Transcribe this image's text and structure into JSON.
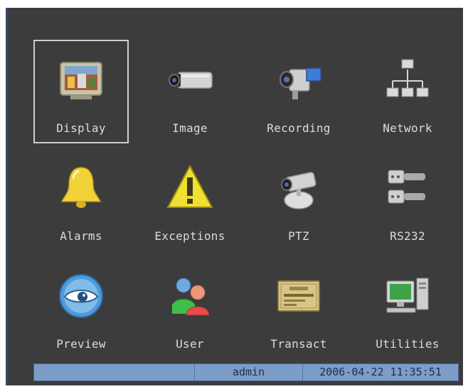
{
  "menu": {
    "items": [
      {
        "label": "Display",
        "icon": "monitor-icon",
        "selected": true
      },
      {
        "label": "Image",
        "icon": "camera-icon"
      },
      {
        "label": "Recording",
        "icon": "camcorder-icon"
      },
      {
        "label": "Network",
        "icon": "network-icon"
      },
      {
        "label": "Alarms",
        "icon": "bell-icon"
      },
      {
        "label": "Exceptions",
        "icon": "warning-icon"
      },
      {
        "label": "PTZ",
        "icon": "ptz-camera-icon"
      },
      {
        "label": "RS232",
        "icon": "serial-connector-icon"
      },
      {
        "label": "Preview",
        "icon": "eye-icon"
      },
      {
        "label": "User",
        "icon": "users-icon"
      },
      {
        "label": "Transact",
        "icon": "card-icon"
      },
      {
        "label": "Utilities",
        "icon": "computer-icon"
      }
    ]
  },
  "status": {
    "left": "",
    "user": "admin",
    "datetime": "2006-04-22 11:35:51"
  },
  "colors": {
    "background": "#3b3b3b",
    "label_text": "#d8dce8",
    "status_bar": "#7d9dc9",
    "selection_frame": "#cfcfcf"
  }
}
